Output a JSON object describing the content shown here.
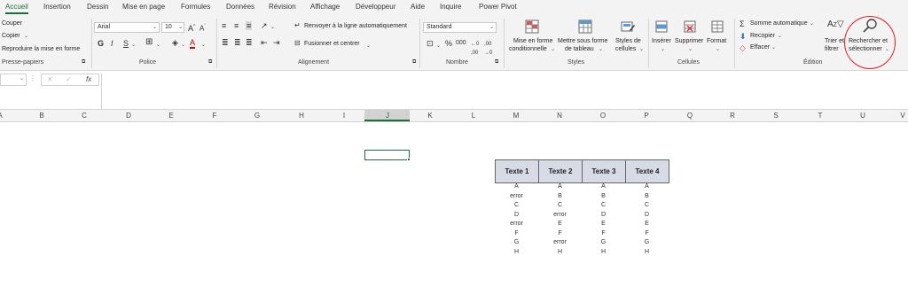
{
  "tabs": [
    "Accueil",
    "Insertion",
    "Dessin",
    "Mise en page",
    "Formules",
    "Données",
    "Révision",
    "Affichage",
    "Développeur",
    "Aide",
    "Inquire",
    "Power Pivot"
  ],
  "clipboard": {
    "cut": "Couper",
    "copy": "Copier",
    "painter": "Reproduire la mise en forme",
    "group": "Presse-papiers"
  },
  "font": {
    "name": "Arial",
    "size": "10",
    "bold": "G",
    "italic": "I",
    "underline": "S",
    "group": "Police"
  },
  "alignment": {
    "wrap": "Renvoyer à la ligne automatiquement",
    "merge": "Fusionner et centrer",
    "group": "Alignement"
  },
  "number": {
    "format": "Standard",
    "group": "Nombre"
  },
  "styles": {
    "conditional": [
      "Mise en forme",
      "conditionnelle"
    ],
    "table": [
      "Mettre sous forme",
      "de tableau"
    ],
    "cell": [
      "Styles de",
      "cellules"
    ],
    "group": "Styles"
  },
  "cells": {
    "insert": "Insérer",
    "delete": "Supprimer",
    "format": "Format",
    "group": "Cellules"
  },
  "editing": {
    "autosum": "Somme automatique",
    "fill": "Recopier",
    "clear": "Effacer",
    "sort": [
      "Trier et",
      "filtrer"
    ],
    "find": [
      "Rechercher et",
      "sélectionner"
    ],
    "group": "Édition"
  },
  "formula_bar": {
    "fx": "fx"
  },
  "columns": [
    "A",
    "B",
    "C",
    "D",
    "E",
    "F",
    "G",
    "H",
    "I",
    "J",
    "K",
    "L",
    "M",
    "N",
    "O",
    "P",
    "Q",
    "R",
    "S",
    "T",
    "U",
    "V"
  ],
  "active_column": "J",
  "table": {
    "headers": [
      "Texte 1",
      "Texte 2",
      "Texte 3",
      "Texte 4"
    ],
    "col1": [
      "A",
      "error",
      "C",
      "D",
      "error",
      "F",
      "G",
      "H"
    ],
    "col2": [
      "A",
      "B",
      "C",
      "error",
      "E",
      "F",
      "error",
      "H"
    ],
    "col3": [
      "A",
      "B",
      "C",
      "D",
      "E",
      "F",
      "G",
      "H"
    ],
    "col4": [
      "A",
      "B",
      "C",
      "D",
      "E",
      "F",
      "G",
      "H"
    ]
  }
}
